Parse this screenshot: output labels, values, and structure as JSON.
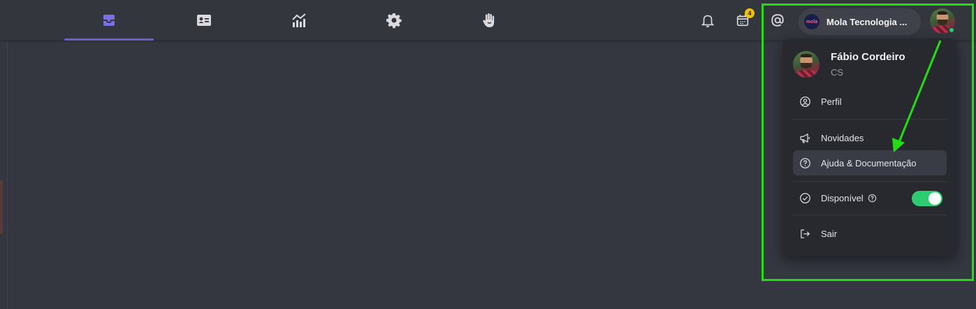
{
  "nav": {
    "tabs": [
      {
        "name": "inbox",
        "icon": "inbox-icon",
        "active": true
      },
      {
        "name": "contacts",
        "icon": "contact-card-icon",
        "active": false
      },
      {
        "name": "reports",
        "icon": "chart-icon",
        "active": false
      },
      {
        "name": "settings",
        "icon": "gear-icon",
        "active": false
      },
      {
        "name": "helpdesk",
        "icon": "hand-icon",
        "active": false
      }
    ],
    "accent_color": "#6a5fd6"
  },
  "header": {
    "calendar_badge": "4",
    "org_name": "Mola Tecnologia ...",
    "org_logo_text": "mola"
  },
  "profile_menu": {
    "user_name": "Fábio Cordeiro",
    "user_role": "CS",
    "items": {
      "profile": "Perfil",
      "news": "Novidades",
      "help": "Ajuda & Documentação",
      "available": "Disponível",
      "logout": "Sair"
    },
    "available_on": true,
    "toggle_color": "#2ecc71"
  },
  "annotation": {
    "highlight_color": "#22dd11"
  }
}
